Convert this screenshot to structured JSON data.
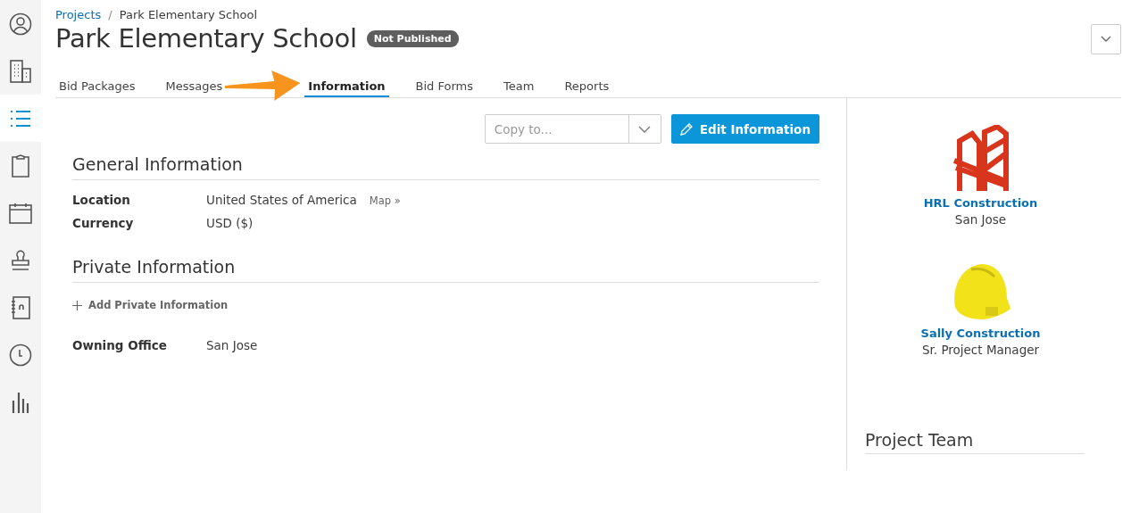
{
  "sidebar": {
    "items": [
      {
        "selected": false
      },
      {
        "selected": false
      },
      {
        "selected": true
      },
      {
        "selected": false
      },
      {
        "selected": false
      },
      {
        "selected": false
      },
      {
        "selected": false
      },
      {
        "selected": false
      },
      {
        "selected": false
      }
    ]
  },
  "breadcrumb": {
    "link": "Projects",
    "separator": "/",
    "current": "Park Elementary School"
  },
  "title": "Park Elementary School",
  "status_badge": "Not Published",
  "tabs": [
    {
      "label": "Bid Packages",
      "selected": false
    },
    {
      "label": "Messages",
      "selected": false
    },
    {
      "label": "Information",
      "selected": true
    },
    {
      "label": "Bid Forms",
      "selected": false
    },
    {
      "label": "Team",
      "selected": false
    },
    {
      "label": "Reports",
      "selected": false
    }
  ],
  "annotation": {
    "kind": "arrow"
  },
  "copy_to": {
    "placeholder": "Copy to..."
  },
  "edit_button": "Edit Information",
  "sections": [
    {
      "heading": "General Information",
      "fields": [
        {
          "label": "Location",
          "value": "United States of America",
          "link": "Map »"
        },
        {
          "label": "Currency",
          "value": "USD ($)"
        }
      ]
    },
    {
      "heading": "Private Information",
      "add_link": "Add Private Information",
      "fields": [
        {
          "label": "Owning Office",
          "value": "San Jose"
        }
      ]
    }
  ],
  "companies": [
    {
      "name": "HRL Construction",
      "detail": "San Jose"
    },
    {
      "name": "Sally Construction",
      "detail": "Sr. Project Manager"
    }
  ],
  "project_team_heading": "Project Team"
}
